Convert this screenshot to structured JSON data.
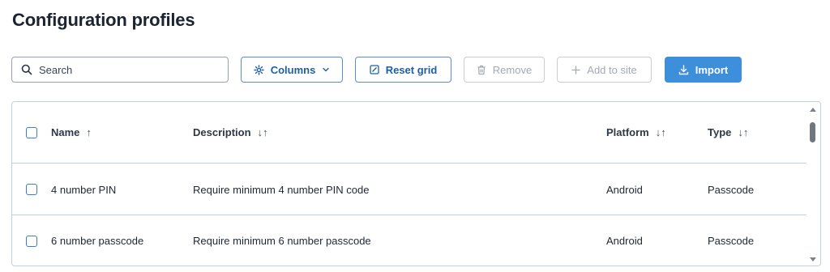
{
  "page": {
    "title": "Configuration profiles"
  },
  "toolbar": {
    "search": {
      "placeholder": "Search",
      "value": ""
    },
    "columns_label": "Columns",
    "reset_grid_label": "Reset grid",
    "remove_label": "Remove",
    "add_to_site_label": "Add to site",
    "import_label": "Import"
  },
  "grid": {
    "columns": {
      "name": "Name",
      "description": "Description",
      "platform": "Platform",
      "type": "Type"
    },
    "sort_icons": {
      "name": "↑",
      "description": "↓↑",
      "platform": "↓↑",
      "type": "↓↑"
    },
    "rows": [
      {
        "name": "4 number PIN",
        "description": "Require minimum 4 number PIN code",
        "platform": "Android",
        "type": "Passcode"
      },
      {
        "name": "6 number passcode",
        "description": "Require minimum 6 number passcode",
        "platform": "Android",
        "type": "Passcode"
      }
    ]
  },
  "colors": {
    "accent": "#1d5fa3",
    "primary_button": "#3d8fdc",
    "border": "#c4d0dc",
    "disabled": "#a3aab3"
  }
}
